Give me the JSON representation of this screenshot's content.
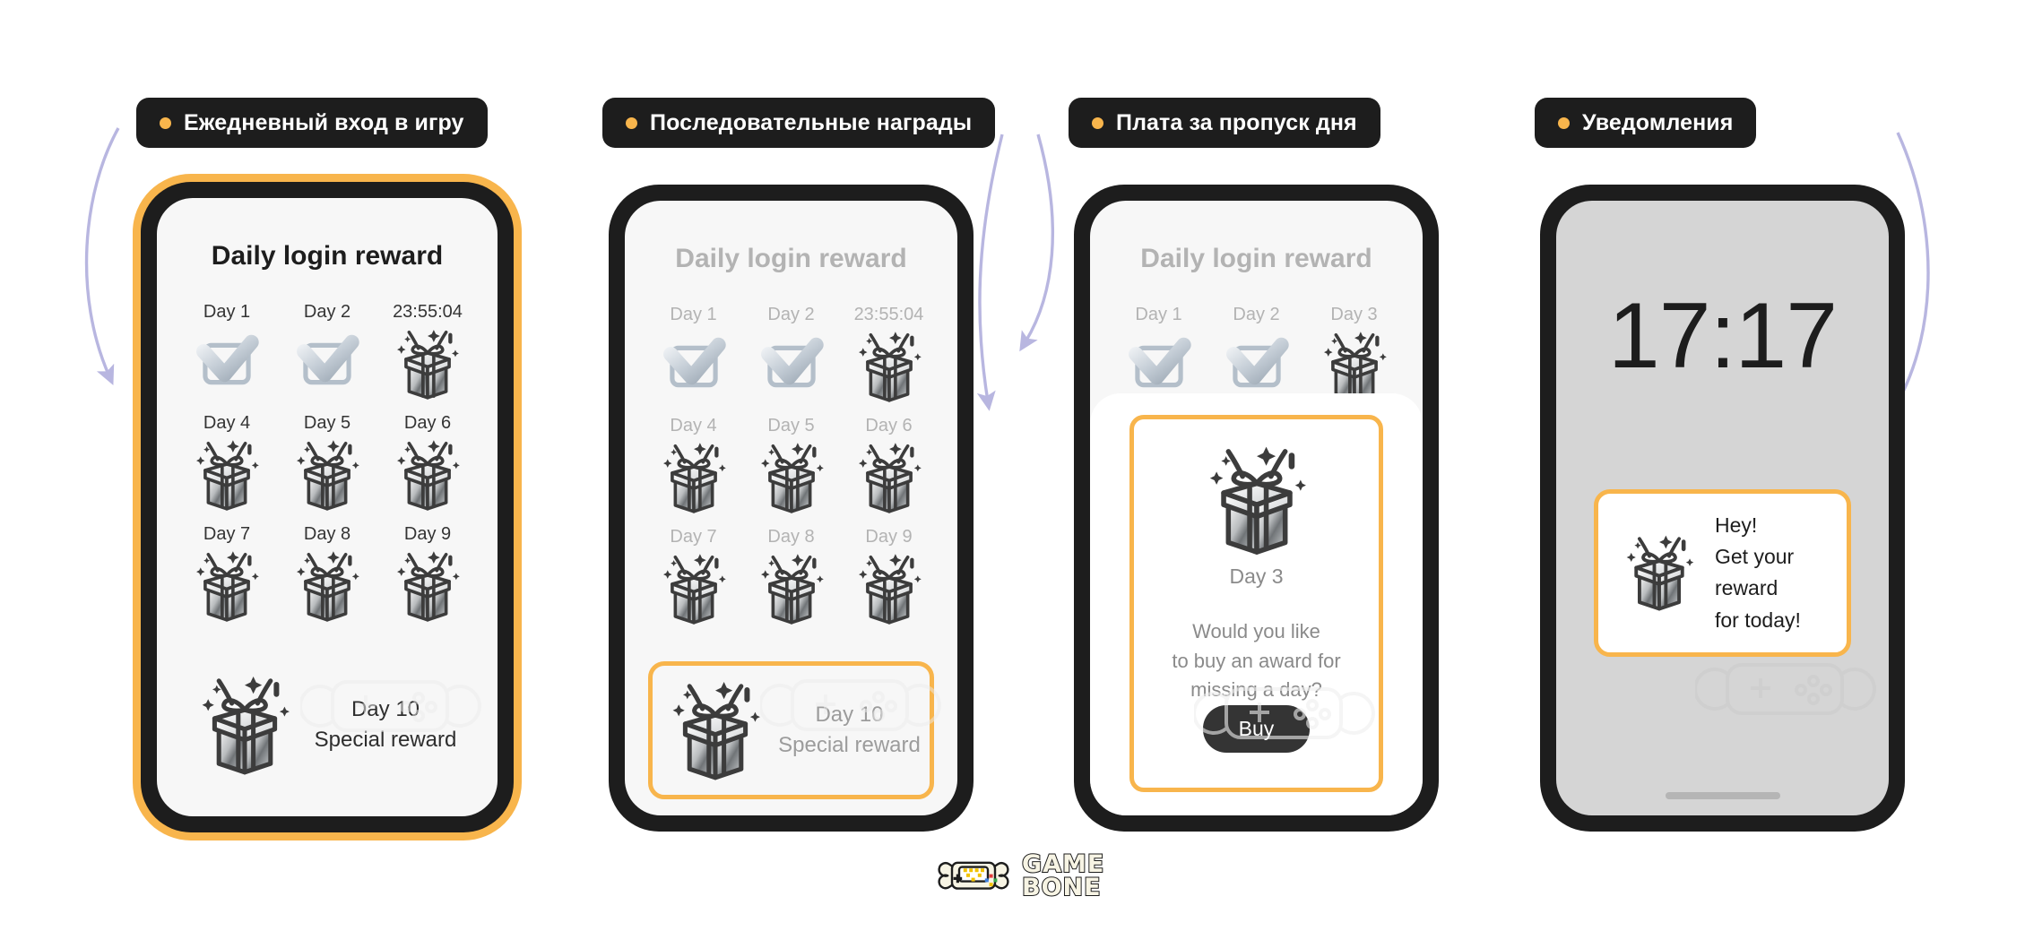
{
  "sections": [
    {
      "id": "daily-login",
      "label": "Ежедневный вход в игру"
    },
    {
      "id": "streak-reward",
      "label": "Последовательные награды"
    },
    {
      "id": "miss-day-fee",
      "label": "Плата за пропуск дня"
    },
    {
      "id": "notifications",
      "label": "Уведомления"
    }
  ],
  "colors": {
    "accent": "#f8b54c",
    "dark": "#1d1d1d",
    "screen_bg": "#f7f7f7",
    "lock_bg": "#d5d5d5",
    "arrow": "#b8b6e0",
    "muted_text": "#b3b3b3"
  },
  "screens": {
    "daily_reward": {
      "title": "Daily login reward",
      "cells": [
        {
          "label": "Day 1",
          "icon": "check-icon"
        },
        {
          "label": "Day 2",
          "icon": "check-icon"
        },
        {
          "label": "23:55:04",
          "icon": "gift-icon"
        },
        {
          "label": "Day 4",
          "icon": "gift-icon"
        },
        {
          "label": "Day 5",
          "icon": "gift-icon"
        },
        {
          "label": "Day 6",
          "icon": "gift-icon"
        },
        {
          "label": "Day 7",
          "icon": "gift-icon"
        },
        {
          "label": "Day 8",
          "icon": "gift-icon"
        },
        {
          "label": "Day 9",
          "icon": "gift-icon"
        }
      ],
      "special": {
        "icon": "gift-icon",
        "day": "Day 10",
        "reward": "Special reward"
      }
    },
    "streak_reward": {
      "title": "Daily login reward",
      "cells": [
        {
          "label": "Day 1",
          "icon": "check-icon"
        },
        {
          "label": "Day 2",
          "icon": "check-icon"
        },
        {
          "label": "23:55:04",
          "icon": "gift-icon"
        },
        {
          "label": "Day 4",
          "icon": "gift-icon"
        },
        {
          "label": "Day 5",
          "icon": "gift-icon"
        },
        {
          "label": "Day 6",
          "icon": "gift-icon"
        },
        {
          "label": "Day 7",
          "icon": "gift-icon"
        },
        {
          "label": "Day 8",
          "icon": "gift-icon"
        },
        {
          "label": "Day 9",
          "icon": "gift-icon"
        }
      ],
      "special": {
        "icon": "gift-icon",
        "day": "Day 10",
        "reward": "Special reward"
      }
    },
    "miss_day": {
      "title": "Daily login reward",
      "cells": [
        {
          "label": "Day 1",
          "icon": "check-icon"
        },
        {
          "label": "Day 2",
          "icon": "check-icon"
        },
        {
          "label": "Day 3",
          "icon": "gift-icon"
        }
      ],
      "modal": {
        "icon": "gift-icon",
        "day": "Day 3",
        "question": "Would you like\nto buy an award for\nmissing a day?",
        "buy_label": "Buy"
      }
    },
    "lock_screen": {
      "time": "17:17",
      "notification": {
        "icon": "gift-icon",
        "text": "Hey!\nGet your reward\nfor today!"
      }
    }
  },
  "brand": {
    "line1": "GAME",
    "line2": "BONE",
    "icon": "gamepad-bone-logo"
  }
}
